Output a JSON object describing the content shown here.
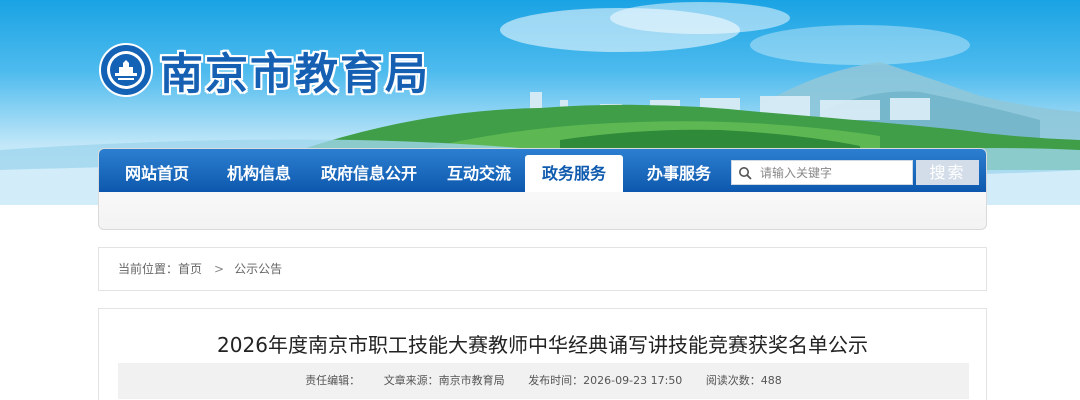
{
  "site": {
    "title": "南京市教育局",
    "logo_icon": "nanjing-education-emblem-icon"
  },
  "nav": {
    "items": [
      {
        "label": "网站首页",
        "active": false
      },
      {
        "label": "机构信息",
        "active": false
      },
      {
        "label": "政府信息公开",
        "active": false
      },
      {
        "label": "互动交流",
        "active": false
      },
      {
        "label": "政务服务",
        "active": true
      },
      {
        "label": "办事服务",
        "active": false
      }
    ],
    "search": {
      "placeholder": "请输入关键字",
      "button_label": "搜索",
      "icon": "search-icon"
    },
    "colors": {
      "bar": "#0d58ae",
      "active_text": "#0e5aae"
    }
  },
  "breadcrumb": {
    "prefix": "当前位置：",
    "home": "首页",
    "separator": ">",
    "current": "公示公告"
  },
  "article": {
    "title": "2026年度南京市职工技能大赛教师中华经典诵写讲技能竞赛获奖名单公示",
    "meta": {
      "editor": "责任编辑：",
      "source": "文章来源：南京市教育局",
      "publish_time": "发布时间：2026-09-23 17:50",
      "views": "阅读次数：488"
    }
  }
}
